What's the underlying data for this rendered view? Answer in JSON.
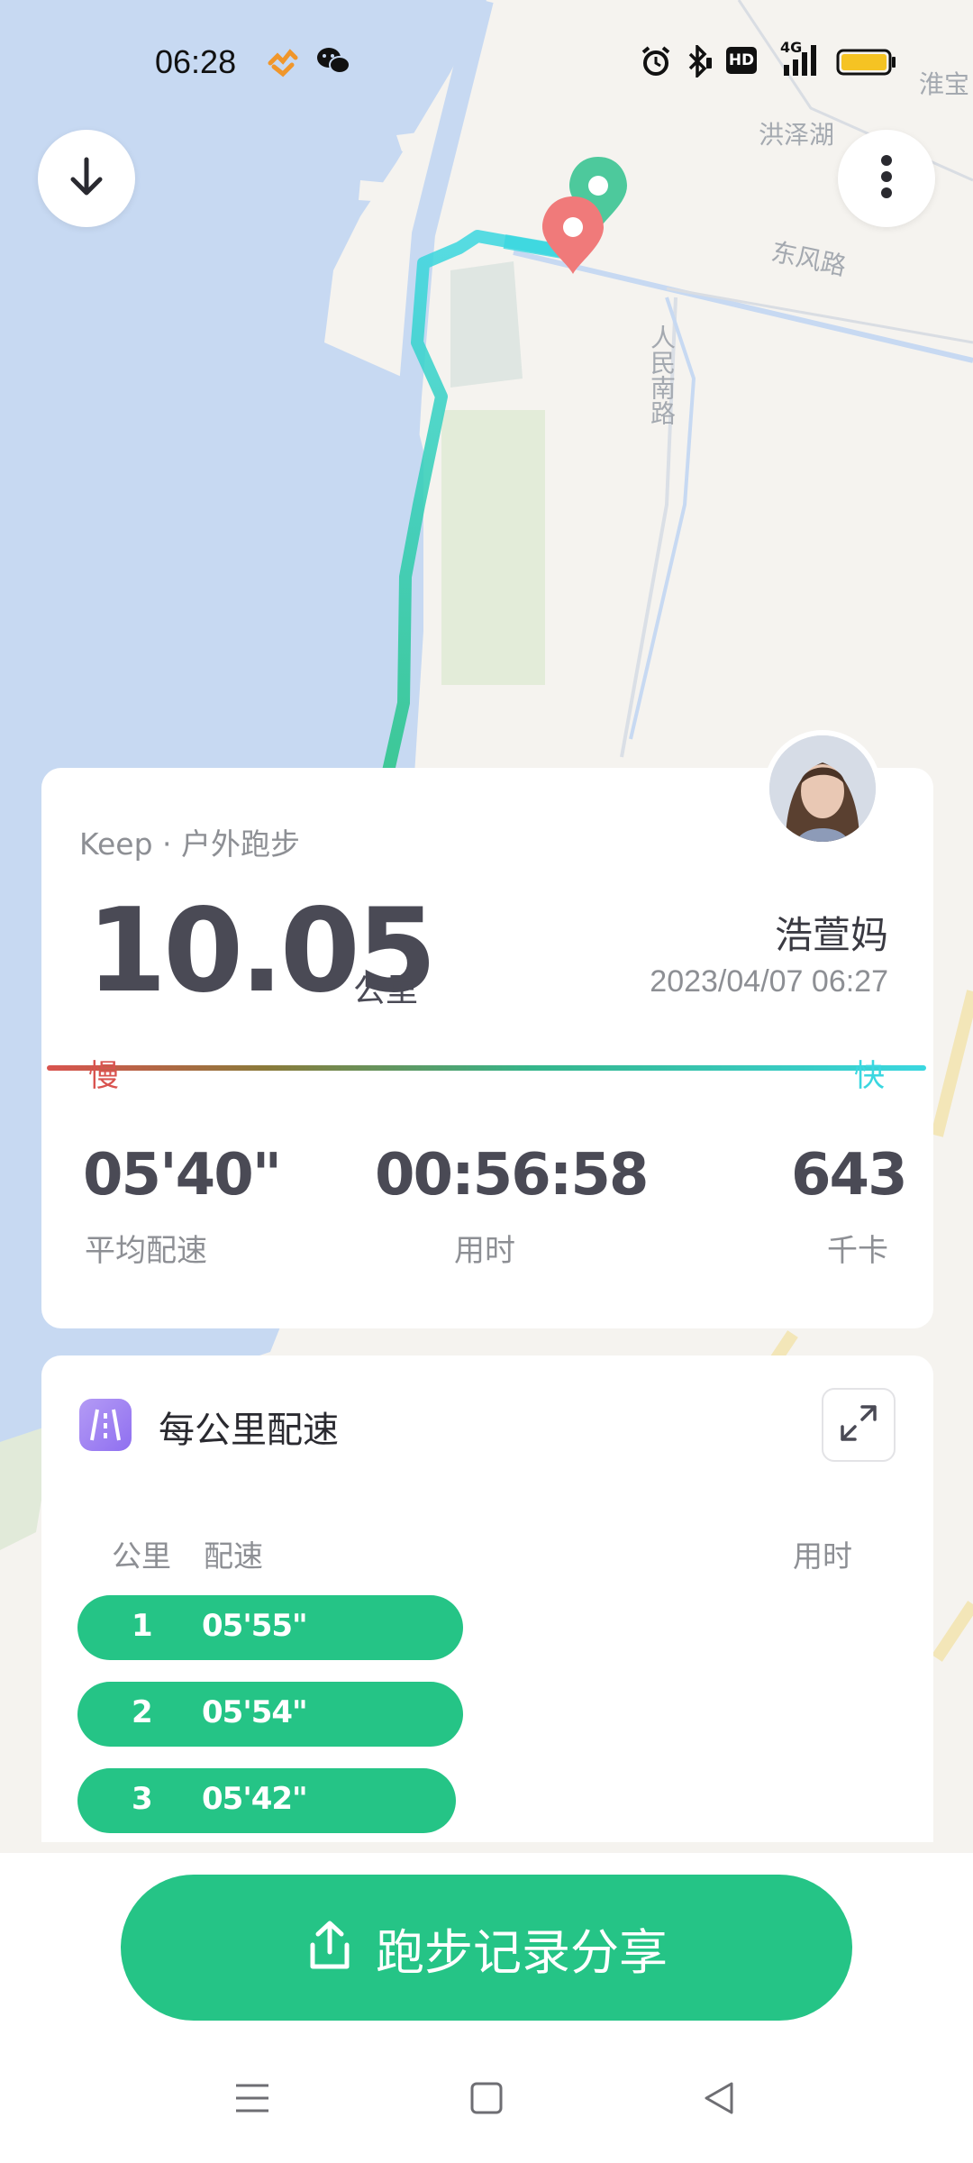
{
  "status_bar": {
    "time": "06:28",
    "icons": [
      "heart-rate-icon",
      "wechat-icon",
      "alarm-icon",
      "bluetooth-icon",
      "hd-icon",
      "4g-signal-icon",
      "battery-icon"
    ],
    "hd_label": "HD",
    "network_label": "4G"
  },
  "map": {
    "labels": {
      "street_top": "淮宝",
      "hongze_lake": "洪泽湖",
      "dongfeng_road": "东风路",
      "renmin_south_road": "人民南路"
    },
    "colors": {
      "water": "#c7d9f2",
      "land": "#f5f3ef",
      "route_start": "#3ad7e0",
      "route_end": "#25c486",
      "start_pin": "#4dc99c",
      "end_pin": "#f07a7a"
    }
  },
  "summary": {
    "source": "Keep · 户外跑步",
    "distance": "10.05",
    "distance_unit": "公里",
    "username": "浩萱妈",
    "datetime": "2023/04/07 06:27",
    "pace_slow_label": "慢",
    "pace_fast_label": "快",
    "stats": [
      {
        "value": "05'40\"",
        "label": "平均配速"
      },
      {
        "value": "00:56:58",
        "label": "用时"
      },
      {
        "value": "643",
        "label": "千卡"
      }
    ]
  },
  "splits": {
    "title": "每公里配速",
    "col_km": "公里",
    "col_pace": "配速",
    "col_time": "用时",
    "rows": [
      {
        "km": "1",
        "pace": "05'55\""
      },
      {
        "km": "2",
        "pace": "05'54\""
      },
      {
        "km": "3",
        "pace": "05'42\""
      }
    ],
    "bar_color": "#25c486"
  },
  "share": {
    "label": "跑步记录分享"
  },
  "colors": {
    "accent": "#25c486",
    "text_primary": "#4a4a55",
    "text_secondary": "#8d8f94"
  }
}
